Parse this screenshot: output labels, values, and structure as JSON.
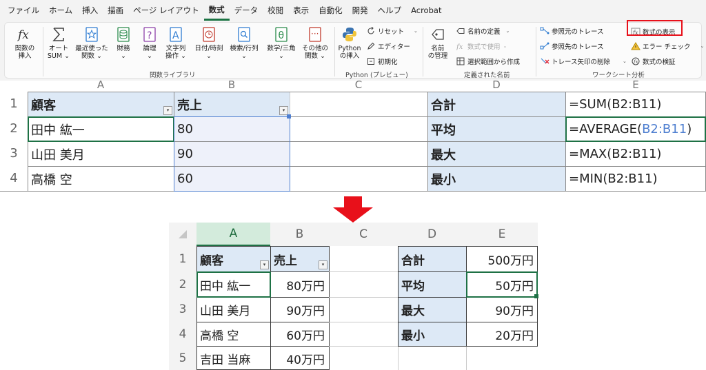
{
  "menu": {
    "tabs": [
      "ファイル",
      "ホーム",
      "挿入",
      "描画",
      "ページ レイアウト",
      "数式",
      "データ",
      "校閲",
      "表示",
      "自動化",
      "開発",
      "ヘルプ",
      "Acrobat"
    ],
    "active_tab": "数式"
  },
  "ribbon": {
    "function_library": {
      "label": "関数ライブラリ",
      "insert_function": "関数の\n挿入",
      "autosum": "オート\nSUM ⌄",
      "recent": "最近使った\n関数 ⌄",
      "financial": "財務\n⌄",
      "logical": "論理\n⌄",
      "text": "文字列\n操作 ⌄",
      "datetime": "日付/時刻\n⌄",
      "lookup": "検索/行列\n⌄",
      "math": "数学/三角\n⌄",
      "more": "その他の\n関数 ⌄"
    },
    "python": {
      "label": "Python (プレビュー)",
      "insert": "Python\nの挿入",
      "reset": "リセット",
      "editor": "エディター",
      "initialize": "初期化"
    },
    "defined_names": {
      "label": "定義された名前",
      "name_manager": "名前\nの管理",
      "define_name": "名前の定義",
      "use_in_formula": "数式で使用",
      "create_from_selection": "選択範囲から作成"
    },
    "formula_auditing": {
      "label": "ワークシート分析",
      "trace_precedents": "参照元のトレース",
      "trace_dependents": "参照先のトレース",
      "remove_arrows": "トレース矢印の削除",
      "show_formulas": "数式の表示",
      "error_checking": "エラー チェック",
      "evaluate_formula": "数式の検証"
    }
  },
  "top_sheet": {
    "columns": [
      "A",
      "B",
      "C",
      "D",
      "E"
    ],
    "rows": [
      "1",
      "2",
      "3",
      "4"
    ],
    "a1": "顧客",
    "b1": "売上",
    "customers": [
      "田中 紘一",
      "山田 美月",
      "高橋 空"
    ],
    "sales": [
      "80",
      "90",
      "60"
    ],
    "stats_labels": [
      "合計",
      "平均",
      "最大",
      "最小"
    ],
    "formulas": [
      "=SUM(B2:B11)",
      "=AVERAGE(",
      "B2:B11",
      ")",
      "=MAX(B2:B11)",
      "=MIN(B2:B11)"
    ]
  },
  "bottom_sheet": {
    "columns": [
      "A",
      "B",
      "C",
      "D",
      "E"
    ],
    "rows": [
      "1",
      "2",
      "3",
      "4",
      "5"
    ],
    "a1": "顧客",
    "b1": "売上",
    "customers": [
      "田中 紘一",
      "山田 美月",
      "高橋 空",
      "吉田 当麻"
    ],
    "sales": [
      "80万円",
      "90万円",
      "60万円",
      "40万円"
    ],
    "stats_labels": [
      "合計",
      "平均",
      "最大",
      "最小"
    ],
    "stats_values": [
      "500万円",
      "50万円",
      "90万円",
      "20万円"
    ]
  },
  "colors": {
    "header_fill": "#dde9f6",
    "accent_green": "#1e7145",
    "highlight_red": "#e8101a",
    "arrow_red": "#e8101a",
    "formula_ref_blue": "#4f7fd0"
  }
}
